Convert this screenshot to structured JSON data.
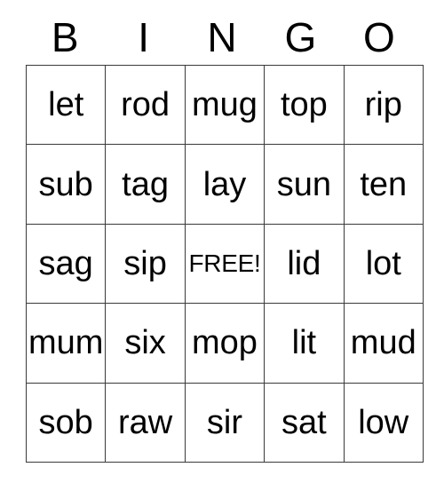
{
  "card": {
    "title_letters": [
      "B",
      "I",
      "N",
      "G",
      "O"
    ],
    "free_space_label": "FREE!",
    "free_space_position": {
      "row": 3,
      "column": 3
    },
    "grid_size": "5x5",
    "colors": {
      "background": "#ffffff",
      "text": "#000000",
      "border": "#3a3a3a"
    },
    "rows": [
      {
        "cells": [
          "let",
          "rod",
          "mug",
          "top",
          "rip"
        ]
      },
      {
        "cells": [
          "sub",
          "tag",
          "lay",
          "sun",
          "ten"
        ]
      },
      {
        "cells": [
          "sag",
          "sip",
          "FREE!",
          "lid",
          "lot"
        ]
      },
      {
        "cells": [
          "mum",
          "six",
          "mop",
          "lit",
          "mud"
        ]
      },
      {
        "cells": [
          "sob",
          "raw",
          "sir",
          "sat",
          "low"
        ]
      }
    ]
  }
}
